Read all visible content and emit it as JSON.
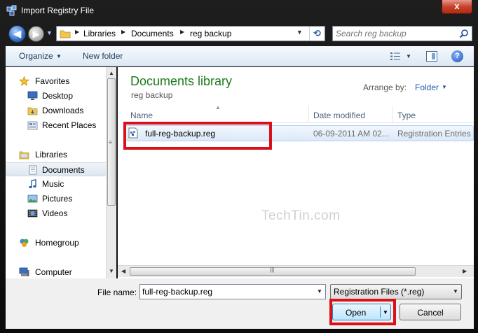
{
  "window": {
    "title": "Import Registry File",
    "close_glyph": "x"
  },
  "nav": {
    "back_icon": "back-arrow-icon",
    "forward_icon": "forward-arrow-icon",
    "breadcrumbs": [
      "Libraries",
      "Documents",
      "reg backup"
    ],
    "search_placeholder": "Search reg backup"
  },
  "toolbar": {
    "organize_label": "Organize",
    "new_folder_label": "New folder",
    "help_glyph": "?"
  },
  "sidebar": {
    "items": [
      {
        "label": "Favorites",
        "icon": "star-icon"
      },
      {
        "label": "Desktop",
        "icon": "desktop-icon"
      },
      {
        "label": "Downloads",
        "icon": "downloads-folder-icon"
      },
      {
        "label": "Recent Places",
        "icon": "recent-places-icon"
      },
      {
        "label": "Libraries",
        "icon": "libraries-icon"
      },
      {
        "label": "Documents",
        "icon": "documents-icon",
        "selected": true
      },
      {
        "label": "Music",
        "icon": "music-icon"
      },
      {
        "label": "Pictures",
        "icon": "pictures-icon"
      },
      {
        "label": "Videos",
        "icon": "videos-icon"
      },
      {
        "label": "Homegroup",
        "icon": "homegroup-icon"
      },
      {
        "label": "Computer",
        "icon": "computer-icon"
      }
    ]
  },
  "content": {
    "library_title": "Documents library",
    "library_subtitle": "reg backup",
    "arrange_by_label": "Arrange by:",
    "arrange_by_value": "Folder",
    "columns": [
      "Name",
      "Date modified",
      "Type"
    ],
    "files": [
      {
        "name": "full-reg-backup.reg",
        "date_modified": "06-09-2011 AM 02...",
        "type": "Registration Entries",
        "icon": "registry-file-icon"
      }
    ],
    "watermark": "TechTin.com"
  },
  "bottom": {
    "file_name_label": "File name:",
    "file_name_value": "full-reg-backup.reg",
    "file_type_value": "Registration Files (*.reg)",
    "open_label": "Open",
    "cancel_label": "Cancel"
  },
  "colors": {
    "library_title": "#1e7a1e",
    "highlight_annotation": "#d8111b",
    "link_blue": "#1e5aa8"
  }
}
